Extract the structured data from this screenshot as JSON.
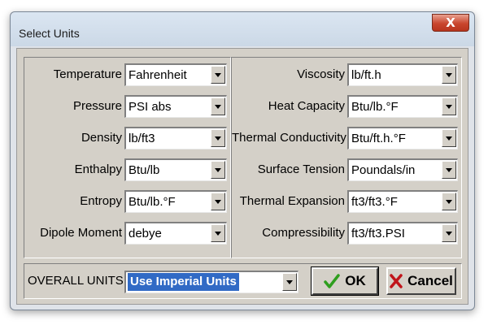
{
  "window": {
    "title": "Select Units",
    "close_glyph": "X"
  },
  "left_fields": [
    {
      "label": "Temperature",
      "value": "Fahrenheit"
    },
    {
      "label": "Pressure",
      "value": "PSI abs"
    },
    {
      "label": "Density",
      "value": "lb/ft3"
    },
    {
      "label": "Enthalpy",
      "value": "Btu/lb"
    },
    {
      "label": "Entropy",
      "value": "Btu/lb.°F"
    },
    {
      "label": "Dipole Moment",
      "value": "debye"
    }
  ],
  "right_fields": [
    {
      "label": "Viscosity",
      "value": "lb/ft.h"
    },
    {
      "label": "Heat Capacity",
      "value": "Btu/lb.°F"
    },
    {
      "label": "Thermal Conductivity",
      "value": "Btu/ft.h.°F"
    },
    {
      "label": "Surface Tension",
      "value": "Poundals/in"
    },
    {
      "label": "Thermal Expansion",
      "value": "ft3/ft3.°F"
    },
    {
      "label": "Compressibility",
      "value": "ft3/ft3.PSI"
    }
  ],
  "overall": {
    "label": "OVERALL UNITS",
    "value": "Use Imperial Units"
  },
  "buttons": {
    "ok_label": "OK",
    "cancel_label": "Cancel"
  },
  "colors": {
    "selection": "#316ac5",
    "ok_check": "#2e9e1e",
    "cancel_x": "#c0141a",
    "close_button": "#c9462e"
  },
  "icons": [
    "close-icon",
    "checkmark-icon",
    "cancel-x-icon",
    "chevron-down-icon"
  ]
}
